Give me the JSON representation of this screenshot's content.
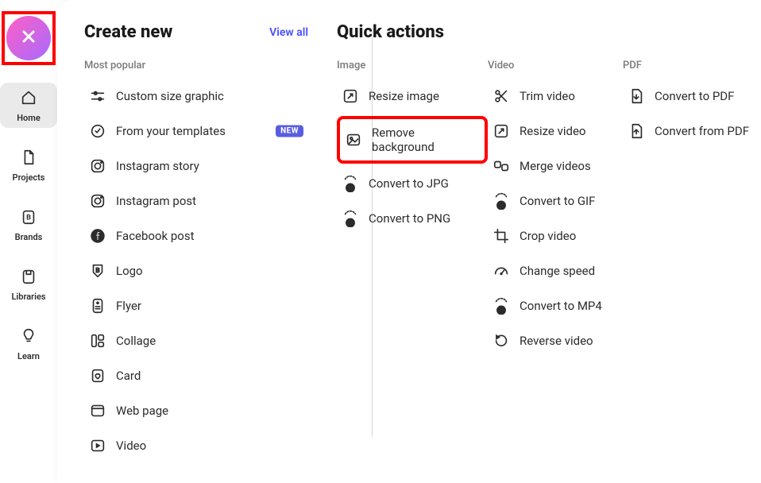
{
  "sidebar": {
    "items": [
      {
        "label": "Home"
      },
      {
        "label": "Projects"
      },
      {
        "label": "Brands"
      },
      {
        "label": "Libraries"
      },
      {
        "label": "Learn"
      }
    ]
  },
  "create": {
    "heading": "Create new",
    "view_all": "View all",
    "subheading": "Most popular",
    "items": [
      {
        "label": "Custom size graphic"
      },
      {
        "label": "From your templates",
        "badge": "NEW"
      },
      {
        "label": "Instagram story"
      },
      {
        "label": "Instagram post"
      },
      {
        "label": "Facebook post"
      },
      {
        "label": "Logo"
      },
      {
        "label": "Flyer"
      },
      {
        "label": "Collage"
      },
      {
        "label": "Card"
      },
      {
        "label": "Web page"
      },
      {
        "label": "Video"
      }
    ]
  },
  "quick": {
    "heading": "Quick actions",
    "columns": [
      {
        "label": "Image",
        "items": [
          {
            "label": "Resize image"
          },
          {
            "label": "Remove background",
            "highlight": true
          },
          {
            "label": "Convert to JPG"
          },
          {
            "label": "Convert to PNG"
          }
        ]
      },
      {
        "label": "Video",
        "items": [
          {
            "label": "Trim video"
          },
          {
            "label": "Resize video"
          },
          {
            "label": "Merge videos"
          },
          {
            "label": "Convert to GIF"
          },
          {
            "label": "Crop video"
          },
          {
            "label": "Change speed"
          },
          {
            "label": "Convert to MP4"
          },
          {
            "label": "Reverse video"
          }
        ]
      },
      {
        "label": "PDF",
        "items": [
          {
            "label": "Convert to PDF"
          },
          {
            "label": "Convert from PDF"
          }
        ]
      }
    ]
  }
}
